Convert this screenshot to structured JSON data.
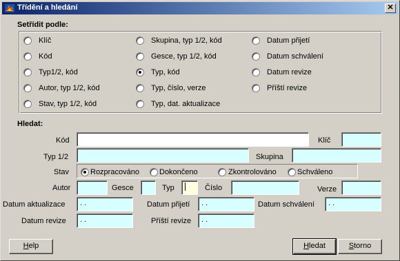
{
  "window": {
    "title": "Třídění a hledání",
    "close_glyph": "✕"
  },
  "sort": {
    "heading": "Setřídit podle:",
    "options": [
      {
        "label": "Klíč"
      },
      {
        "label": "Kód"
      },
      {
        "label": "Typ1/2, kód"
      },
      {
        "label": "Autor, typ 1/2, kód"
      },
      {
        "label": "Stav, typ 1/2, kód"
      },
      {
        "label": "Skupina, typ 1/2, kód"
      },
      {
        "label": "Gesce, typ 1/2, kód"
      },
      {
        "label": "Typ, kód",
        "selected": true
      },
      {
        "label": "Typ, číslo, verze"
      },
      {
        "label": "Typ, dat. aktualizace"
      },
      {
        "label": "Datum přijetí"
      },
      {
        "label": "Datum schválení"
      },
      {
        "label": "Datum revize"
      },
      {
        "label": "Příští revize"
      }
    ]
  },
  "search": {
    "heading": "Hledat:",
    "labels": {
      "kod": "Kód",
      "klic": "Klíč",
      "typ12": "Typ 1/2",
      "skupina": "Skupina",
      "stav": "Stav",
      "autor": "Autor",
      "gesce": "Gesce",
      "typ": "Typ",
      "cislo": "Číslo",
      "verze": "Verze",
      "datum_aktualizace": "Datum aktualizace",
      "datum_prijeti": "Datum přijetí",
      "datum_schvaleni": "Datum schválení",
      "datum_revize": "Datum revize",
      "pristi_revize": "Příští revize"
    },
    "stav_options": [
      {
        "label": "Rozpracováno",
        "selected": true
      },
      {
        "label": "Dokončeno"
      },
      {
        "label": "Zkontrolováno"
      },
      {
        "label": "Schváleno"
      }
    ],
    "date_placeholder": " .  ."
  },
  "buttons": {
    "help": {
      "hotkey": "H",
      "rest": "elp"
    },
    "find": {
      "hotkey": "H",
      "rest": "ledat"
    },
    "cancel": {
      "hotkey": "S",
      "rest": "torno"
    }
  },
  "colors": {
    "field_bg": "#d8ffff",
    "dialog_bg": "#d4d0c8",
    "title_bg": "#0a246a"
  }
}
